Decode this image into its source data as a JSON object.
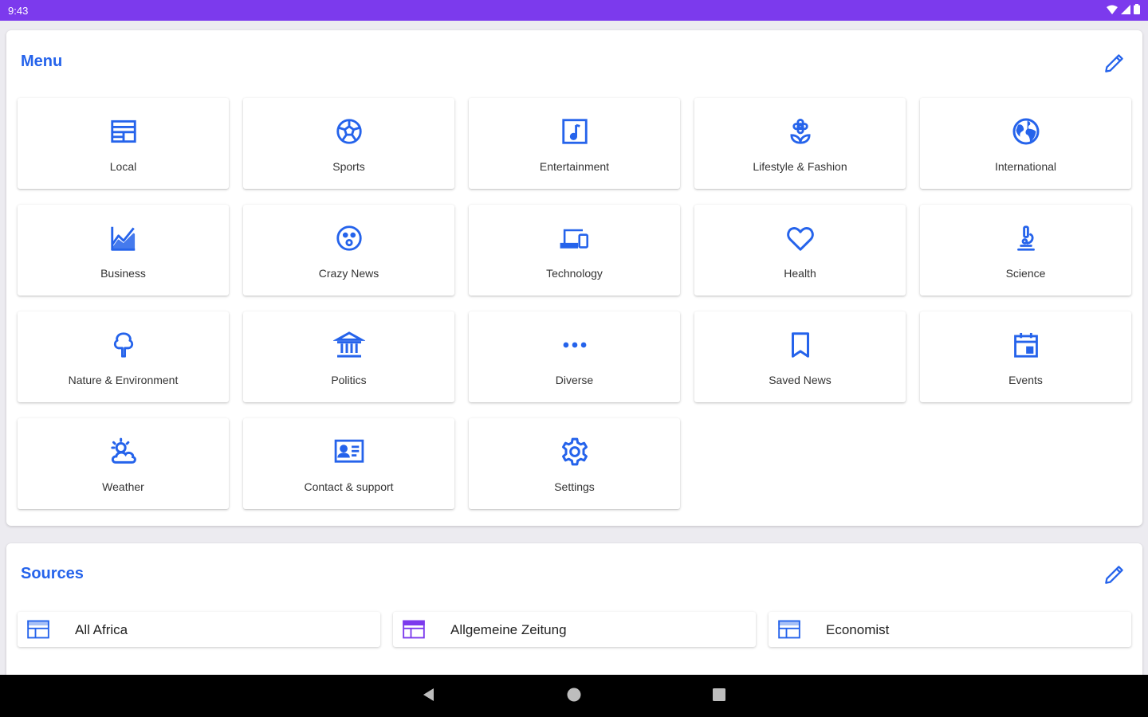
{
  "status_bar": {
    "time": "9:43",
    "icons": [
      "wifi-icon",
      "signal-icon",
      "battery-icon"
    ]
  },
  "theme": {
    "accent": "#2563eb",
    "status_bar": "#7c3aed",
    "source_icon_purple": "#7c3aed"
  },
  "menu": {
    "title": "Menu",
    "edit_icon": "pencil-icon",
    "items": [
      {
        "label": "Local",
        "icon": "newspaper-icon"
      },
      {
        "label": "Sports",
        "icon": "soccer-ball-icon"
      },
      {
        "label": "Entertainment",
        "icon": "music-note-icon"
      },
      {
        "label": "Lifestyle & Fashion",
        "icon": "flower-icon"
      },
      {
        "label": "International",
        "icon": "globe-icon"
      },
      {
        "label": "Business",
        "icon": "area-chart-icon"
      },
      {
        "label": "Crazy News",
        "icon": "surprised-face-icon"
      },
      {
        "label": "Technology",
        "icon": "devices-icon"
      },
      {
        "label": "Health",
        "icon": "heart-icon"
      },
      {
        "label": "Science",
        "icon": "microscope-icon"
      },
      {
        "label": "Nature & Environment",
        "icon": "tree-icon"
      },
      {
        "label": "Politics",
        "icon": "government-building-icon"
      },
      {
        "label": "Diverse",
        "icon": "more-dots-icon"
      },
      {
        "label": "Saved News",
        "icon": "bookmark-icon"
      },
      {
        "label": "Events",
        "icon": "calendar-icon"
      },
      {
        "label": "Weather",
        "icon": "sun-cloud-icon"
      },
      {
        "label": "Contact & support",
        "icon": "contact-card-icon"
      },
      {
        "label": "Settings",
        "icon": "gear-icon"
      }
    ]
  },
  "sources": {
    "title": "Sources",
    "edit_icon": "pencil-icon",
    "items": [
      {
        "label": "All Africa",
        "icon": "news-source-icon"
      },
      {
        "label": "Allgemeine Zeitung",
        "icon": "news-source-icon"
      },
      {
        "label": "Economist",
        "icon": "news-source-icon"
      }
    ]
  },
  "nav_bar": {
    "buttons": [
      "back-icon",
      "home-icon",
      "recents-icon"
    ]
  }
}
